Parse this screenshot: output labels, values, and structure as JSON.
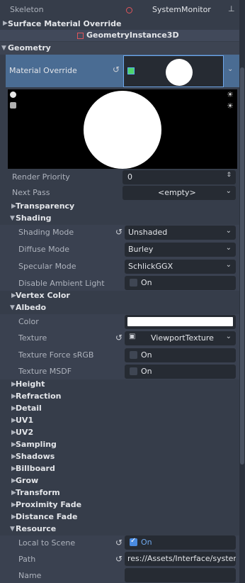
{
  "skeleton": {
    "label": "Skeleton",
    "value": "SystemMonitor"
  },
  "surface_material_override": "Surface Material Override",
  "geometry_instance": "GeometryInstance3D",
  "geometry": "Geometry",
  "material_override": "Material Override",
  "render_priority": {
    "label": "Render Priority",
    "value": "0"
  },
  "next_pass": {
    "label": "Next Pass",
    "value": "<empty>"
  },
  "sections": {
    "transparency": "Transparency",
    "shading": "Shading",
    "vertex_color": "Vertex Color",
    "albedo": "Albedo",
    "height": "Height",
    "refraction": "Refraction",
    "detail": "Detail",
    "uv1": "UV1",
    "uv2": "UV2",
    "sampling": "Sampling",
    "shadows": "Shadows",
    "billboard": "Billboard",
    "grow": "Grow",
    "transform": "Transform",
    "proximity_fade": "Proximity Fade",
    "distance_fade": "Distance Fade",
    "resource": "Resource"
  },
  "shading": {
    "shading_mode": {
      "label": "Shading Mode",
      "value": "Unshaded"
    },
    "diffuse_mode": {
      "label": "Diffuse Mode",
      "value": "Burley"
    },
    "specular_mode": {
      "label": "Specular Mode",
      "value": "SchlickGGX"
    },
    "disable_ambient_light": {
      "label": "Disable Ambient Light",
      "value": "On"
    }
  },
  "albedo": {
    "color": {
      "label": "Color",
      "hex": "#ffffff"
    },
    "texture": {
      "label": "Texture",
      "value": "ViewportTexture"
    },
    "texture_force_srgb": {
      "label": "Texture Force sRGB",
      "value": "On"
    },
    "texture_msdf": {
      "label": "Texture MSDF",
      "value": "On"
    }
  },
  "resource": {
    "local_to_scene": {
      "label": "Local to Scene",
      "value": "On"
    },
    "path": {
      "label": "Path",
      "value": "res://Assets/Interface/system_"
    },
    "name": {
      "label": "Name",
      "value": ""
    }
  }
}
